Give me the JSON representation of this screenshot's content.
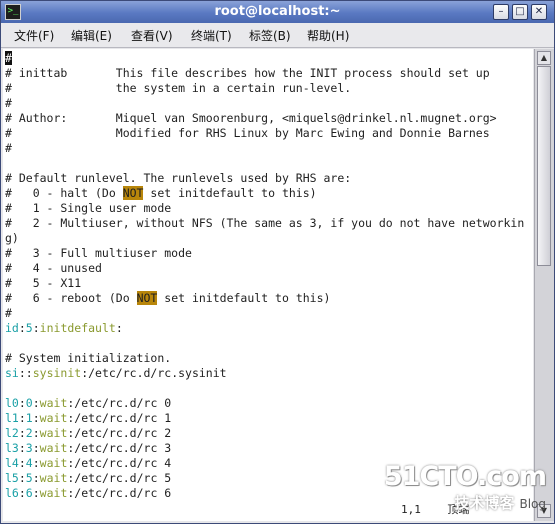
{
  "window": {
    "title": "root@localhost:~",
    "min_icon": "minimize-icon",
    "max_icon": "maximize-icon",
    "close_icon": "close-icon"
  },
  "menu": [
    {
      "label": "文件(F)"
    },
    {
      "label": "编辑(E)"
    },
    {
      "label": "查看(V)"
    },
    {
      "label": "终端(T)"
    },
    {
      "label": "标签(B)"
    },
    {
      "label": "帮助(H)"
    }
  ],
  "lines": [
    {
      "parts": [
        {
          "t": "#",
          "c": "cursor"
        }
      ]
    },
    {
      "parts": [
        {
          "t": "# inittab       This file describes how the INIT process should set up"
        }
      ]
    },
    {
      "parts": [
        {
          "t": "#               the system in a certain run-level."
        }
      ]
    },
    {
      "parts": [
        {
          "t": "#"
        }
      ]
    },
    {
      "parts": [
        {
          "t": "# Author:       Miquel van Smoorenburg, <miquels@drinkel.nl.mugnet.org>"
        }
      ]
    },
    {
      "parts": [
        {
          "t": "#               Modified for RHS Linux by Marc Ewing and Donnie Barnes"
        }
      ]
    },
    {
      "parts": [
        {
          "t": "#"
        }
      ]
    },
    {
      "parts": [
        {
          "t": ""
        }
      ]
    },
    {
      "parts": [
        {
          "t": "# Default runlevel. The runlevels used by RHS are:"
        }
      ]
    },
    {
      "parts": [
        {
          "t": "#   0 - halt (Do "
        },
        {
          "t": "NOT",
          "c": "hl"
        },
        {
          "t": " set initdefault to this)"
        }
      ]
    },
    {
      "parts": [
        {
          "t": "#   1 - Single user mode"
        }
      ]
    },
    {
      "parts": [
        {
          "t": "#   2 - Multiuser, without NFS (The same as 3, if you do not have networkin"
        }
      ]
    },
    {
      "parts": [
        {
          "t": "g)"
        }
      ]
    },
    {
      "parts": [
        {
          "t": "#   3 - Full multiuser mode"
        }
      ]
    },
    {
      "parts": [
        {
          "t": "#   4 - unused"
        }
      ]
    },
    {
      "parts": [
        {
          "t": "#   5 - X11"
        }
      ]
    },
    {
      "parts": [
        {
          "t": "#   6 - reboot (Do "
        },
        {
          "t": "NOT",
          "c": "hl"
        },
        {
          "t": " set initdefault to this)"
        }
      ]
    },
    {
      "parts": [
        {
          "t": "#"
        }
      ]
    },
    {
      "parts": [
        {
          "t": "id",
          "c": "teal"
        },
        {
          "t": ":"
        },
        {
          "t": "5",
          "c": "teal"
        },
        {
          "t": ":"
        },
        {
          "t": "initdefault",
          "c": "olive"
        },
        {
          "t": ":"
        }
      ]
    },
    {
      "parts": [
        {
          "t": ""
        }
      ]
    },
    {
      "parts": [
        {
          "t": "# System initialization."
        }
      ]
    },
    {
      "parts": [
        {
          "t": "si",
          "c": "teal"
        },
        {
          "t": "::"
        },
        {
          "t": "sysinit",
          "c": "olive"
        },
        {
          "t": ":/etc/rc.d/rc.sysinit"
        }
      ]
    },
    {
      "parts": [
        {
          "t": ""
        }
      ]
    },
    {
      "parts": [
        {
          "t": "l0",
          "c": "teal"
        },
        {
          "t": ":"
        },
        {
          "t": "0",
          "c": "teal"
        },
        {
          "t": ":"
        },
        {
          "t": "wait",
          "c": "olive"
        },
        {
          "t": ":/etc/rc.d/rc 0"
        }
      ]
    },
    {
      "parts": [
        {
          "t": "l1",
          "c": "teal"
        },
        {
          "t": ":"
        },
        {
          "t": "1",
          "c": "teal"
        },
        {
          "t": ":"
        },
        {
          "t": "wait",
          "c": "olive"
        },
        {
          "t": ":/etc/rc.d/rc 1"
        }
      ]
    },
    {
      "parts": [
        {
          "t": "l2",
          "c": "teal"
        },
        {
          "t": ":"
        },
        {
          "t": "2",
          "c": "teal"
        },
        {
          "t": ":"
        },
        {
          "t": "wait",
          "c": "olive"
        },
        {
          "t": ":/etc/rc.d/rc 2"
        }
      ]
    },
    {
      "parts": [
        {
          "t": "l3",
          "c": "teal"
        },
        {
          "t": ":"
        },
        {
          "t": "3",
          "c": "teal"
        },
        {
          "t": ":"
        },
        {
          "t": "wait",
          "c": "olive"
        },
        {
          "t": ":/etc/rc.d/rc 3"
        }
      ]
    },
    {
      "parts": [
        {
          "t": "l4",
          "c": "teal"
        },
        {
          "t": ":"
        },
        {
          "t": "4",
          "c": "teal"
        },
        {
          "t": ":"
        },
        {
          "t": "wait",
          "c": "olive"
        },
        {
          "t": ":/etc/rc.d/rc 4"
        }
      ]
    },
    {
      "parts": [
        {
          "t": "l5",
          "c": "teal"
        },
        {
          "t": ":"
        },
        {
          "t": "5",
          "c": "teal"
        },
        {
          "t": ":"
        },
        {
          "t": "wait",
          "c": "olive"
        },
        {
          "t": ":/etc/rc.d/rc 5"
        }
      ]
    },
    {
      "parts": [
        {
          "t": "l6",
          "c": "teal"
        },
        {
          "t": ":"
        },
        {
          "t": "6",
          "c": "teal"
        },
        {
          "t": ":"
        },
        {
          "t": "wait",
          "c": "olive"
        },
        {
          "t": ":/etc/rc.d/rc 6"
        }
      ]
    }
  ],
  "status": {
    "position": "1,1",
    "scroll": "顶端"
  },
  "watermark": {
    "site": "51CTO.com",
    "sub": "技术博客",
    "blog": "Blog"
  },
  "colors": {
    "titlebar": "#5a79c2",
    "highlight": "#b8860b",
    "keyword": "#1aa0a6",
    "action": "#8a9a2f"
  }
}
